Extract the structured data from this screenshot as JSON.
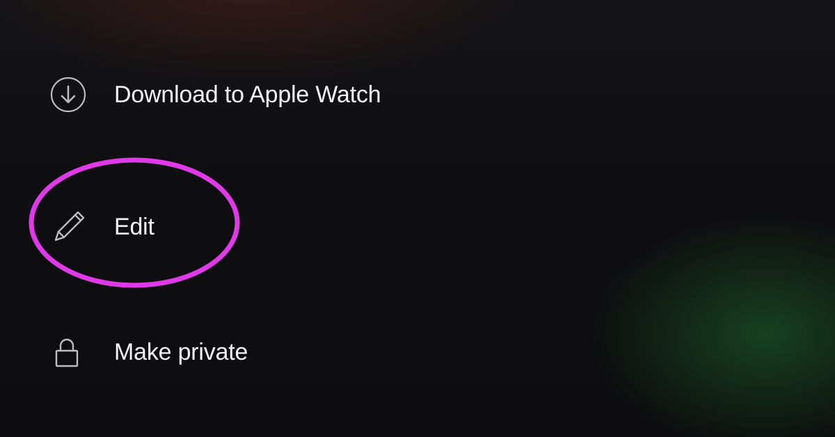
{
  "menu": {
    "items": [
      {
        "label": "Download to Apple Watch"
      },
      {
        "label": "Edit"
      },
      {
        "label": "Make private"
      }
    ]
  },
  "annotation": {
    "highlight_color": "#e03ae8"
  }
}
